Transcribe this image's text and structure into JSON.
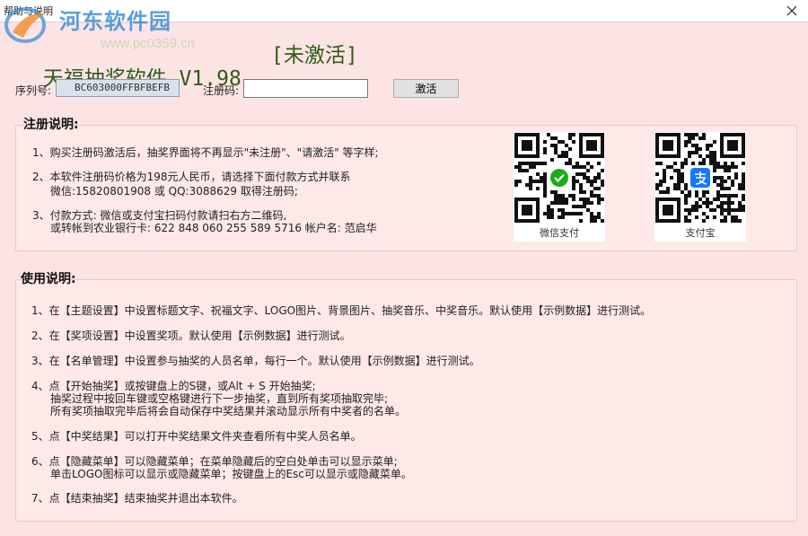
{
  "window": {
    "title": "帮助与说明",
    "close_glyph": "✕"
  },
  "watermark": {
    "site_name": "河东软件园",
    "url": "www.pc0359.cn",
    "logo": "hedong-logo-icon"
  },
  "app": {
    "title": "天福抽奖软件 V1.98",
    "status": "[未激活]",
    "title_color": "#2e5c1a"
  },
  "registration": {
    "serial_label": "序列号:",
    "serial_value": "BC603000FFBFBEFB",
    "code_label": "注册码:",
    "code_value": "",
    "activate_label": "激活"
  },
  "reg_notes": {
    "heading": "注册说明:",
    "lines": [
      "1、购买注册码激活后，抽奖界面将不再显示\"未注册\"、\"请激活\" 等字样;",
      "2、本软件注册码价格为198元人民币，请选择下面付款方式并联系",
      "微信:15820801908 或 QQ:3088629 取得注册码;",
      "3、付款方式:  微信或支付宝扫码付款请扫右方二维码,",
      "或转帐到农业银行卡: 622 848 060 255 589 5716 帐户名: 范启华"
    ],
    "qr_wechat": {
      "caption": "微信支付",
      "icon": "wechat-pay-icon",
      "color": "#1aad19"
    },
    "qr_alipay": {
      "caption": "支付宝",
      "icon": "alipay-icon",
      "color": "#1677ff"
    }
  },
  "usage": {
    "heading": "使用说明:",
    "lines": [
      "1、在【主题设置】中设置标题文字、祝福文字、LOGO图片、背景图片、抽奖音乐、中奖音乐。默认使用【示例数据】进行测试。",
      "2、在【奖项设置】中设置奖项。默认使用【示例数据】进行测试。",
      "3、在【名单管理】中设置参与抽奖的人员名单，每行一个。默认使用【示例数据】进行测试。",
      "4、点【开始抽奖】或按键盘上的S键，或Alt + S 开始抽奖;",
      "抽奖过程中按回车键或空格键进行下一步抽奖，直到所有奖项抽取完毕;",
      "所有奖项抽取完毕后将会自动保存中奖结果并滚动显示所有中奖者的名单。",
      "5、点【中奖结果】可以打开中奖结果文件夹查看所有中奖人员名单。",
      "6、点【隐藏菜单】可以隐藏菜单；在菜单隐藏后的空白处单击可以显示菜单;",
      "单击LOGO图标可以显示或隐藏菜单；按键盘上的Esc可以显示或隐藏菜单。",
      "7、点【结束抽奖】结束抽奖并退出本软件。"
    ]
  },
  "colors": {
    "background": "#fde4e4",
    "panel_border": "#ecc8c8"
  }
}
